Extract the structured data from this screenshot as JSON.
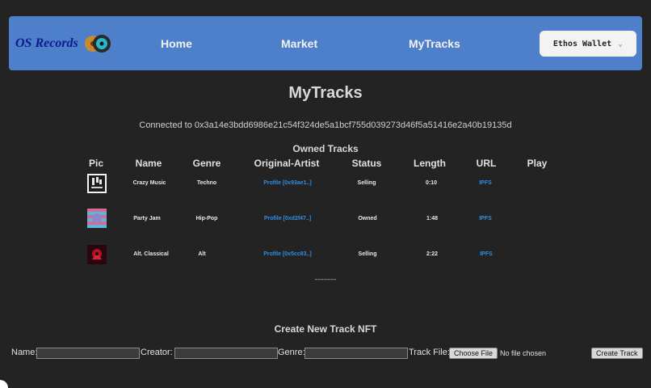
{
  "nav": {
    "brand": "OS Records",
    "links": [
      "Home",
      "Market",
      "MyTracks"
    ],
    "wallet_label": "Ethos Wallet"
  },
  "page": {
    "title": "MyTracks",
    "connected": "Connected to 0x3a14e3bdd6986e21c54f324de5a1bcf755d039273d46f5a51416e2a40b19135d"
  },
  "owned": {
    "title": "Owned Tracks",
    "columns": [
      "Pic",
      "Name",
      "Genre",
      "Original-Artist",
      "Status",
      "Length",
      "URL",
      "Play"
    ],
    "rows": [
      {
        "name": "Crazy Music",
        "genre": "Techno",
        "artist": "Profile [0x93ae1..]",
        "status": "Selling",
        "length": "0:10",
        "url": "IPFS"
      },
      {
        "name": "Party Jam",
        "genre": "Hip-Pop",
        "artist": "Profile [0xd2f47..]",
        "status": "Owned",
        "length": "1:48",
        "url": "IPFS"
      },
      {
        "name": "Alt. Classical",
        "genre": "Alt",
        "artist": "Profile [0x5cc83..]",
        "status": "Selling",
        "length": "2:22",
        "url": "IPFS"
      }
    ],
    "divider": "----------"
  },
  "create": {
    "title": "Create New Track NFT",
    "name_label": "Name:",
    "creator_label": "Creator:",
    "genre_label": "Genre:",
    "file_label": "Track File:",
    "choose_file": "Choose File",
    "no_file": "No file chosen",
    "submit": "Create Track"
  },
  "colors": {
    "navbar": "#4d7fcb",
    "link": "#2f8fe0",
    "background": "#232323",
    "brand": "#0d1a8a"
  }
}
